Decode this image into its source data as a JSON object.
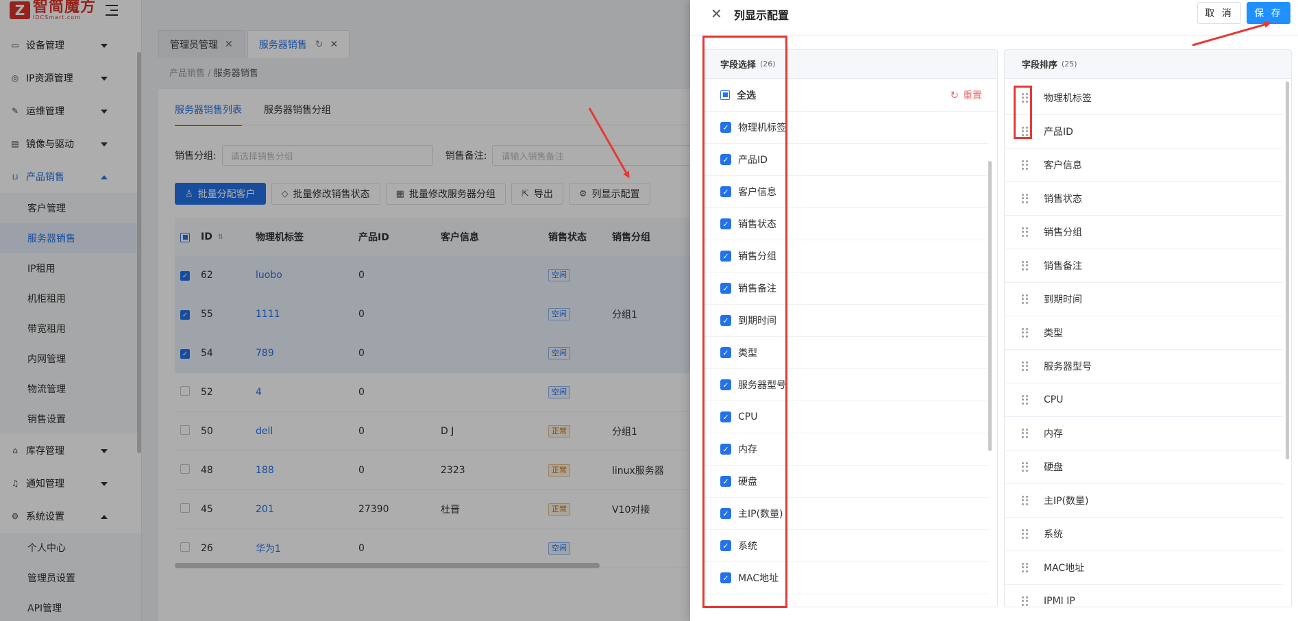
{
  "brand": {
    "logo_mark": "Z",
    "name": "智简魔方",
    "sub": "IDCSmart.com"
  },
  "sidebar": {
    "groups": [
      {
        "label": "设备管理",
        "icon": "monitor-icon",
        "open": false
      },
      {
        "label": "IP资源管理",
        "icon": "network-icon",
        "open": false
      },
      {
        "label": "运维管理",
        "icon": "wrench-icon",
        "open": false
      },
      {
        "label": "镜像与驱动",
        "icon": "image-icon",
        "open": false
      },
      {
        "label": "产品销售",
        "icon": "bag-icon",
        "open": true,
        "active": true,
        "children": [
          "客户管理",
          "服务器销售",
          "IP租用",
          "机柜租用",
          "带宽租用",
          "内网管理",
          "物流管理",
          "销售设置"
        ]
      },
      {
        "label": "库存管理",
        "icon": "warehouse-icon",
        "open": false
      },
      {
        "label": "通知管理",
        "icon": "bell-icon",
        "open": false
      },
      {
        "label": "系统设置",
        "icon": "gear-icon",
        "open": true,
        "children": [
          "个人中心",
          "管理员设置",
          "API管理"
        ]
      }
    ],
    "active_child": "服务器销售"
  },
  "tabs": [
    {
      "label": "管理员管理",
      "active": false
    },
    {
      "label": "服务器销售",
      "active": true
    }
  ],
  "breadcrumb": {
    "parent": "产品销售",
    "sep": "/",
    "current": "服务器销售"
  },
  "sub_tabs": [
    {
      "label": "服务器销售列表",
      "active": true
    },
    {
      "label": "服务器销售分组",
      "active": false
    }
  ],
  "filters": [
    {
      "label": "销售分组:",
      "placeholder": "请选择销售分组"
    },
    {
      "label": "销售备注:",
      "placeholder": "请输入销售备注"
    }
  ],
  "toolbar": [
    {
      "label": "批量分配客户",
      "icon": "user-icon",
      "primary": true
    },
    {
      "label": "批量修改销售状态",
      "icon": "tag-icon",
      "primary": false
    },
    {
      "label": "批量修改服务器分组",
      "icon": "server-icon",
      "primary": false
    },
    {
      "label": "导出",
      "icon": "export-icon",
      "primary": false
    },
    {
      "label": "列显示配置",
      "icon": "gear-icon",
      "primary": false
    }
  ],
  "table": {
    "headers": [
      "ID",
      "物理机标签",
      "产品ID",
      "客户信息",
      "销售状态",
      "销售分组"
    ],
    "rows": [
      {
        "id": "62",
        "tag": "luobo",
        "pid": "0",
        "cust": "",
        "status": "空闲",
        "status_type": "idle",
        "group": "",
        "checked": true
      },
      {
        "id": "55",
        "tag": "1111",
        "pid": "0",
        "cust": "",
        "status": "空闲",
        "status_type": "idle",
        "group": "分组1",
        "checked": true
      },
      {
        "id": "54",
        "tag": "789",
        "pid": "0",
        "cust": "",
        "status": "空闲",
        "status_type": "idle",
        "group": "",
        "checked": true
      },
      {
        "id": "52",
        "tag": "4",
        "pid": "0",
        "cust": "",
        "status": "空闲",
        "status_type": "idle",
        "group": "",
        "checked": false
      },
      {
        "id": "50",
        "tag": "dell",
        "pid": "0",
        "cust": "D J",
        "status": "正常",
        "status_type": "normal",
        "group": "分组1",
        "checked": false
      },
      {
        "id": "48",
        "tag": "188",
        "pid": "0",
        "cust": "2323",
        "status": "正常",
        "status_type": "normal",
        "group": "linux服务器",
        "checked": false
      },
      {
        "id": "45",
        "tag": "201",
        "pid": "27390",
        "cust": "杜晋",
        "status": "正常",
        "status_type": "normal",
        "group": "V10对接",
        "checked": false
      },
      {
        "id": "26",
        "tag": "华为1",
        "pid": "0",
        "cust": "",
        "status": "空闲",
        "status_type": "idle",
        "group": "",
        "checked": false
      }
    ]
  },
  "drawer": {
    "title": "列显示配置",
    "cancel": "取 消",
    "save": "保 存",
    "left": {
      "title": "字段选择",
      "count": "(26)",
      "select_all": "全选",
      "reset": "重置",
      "fields": [
        "物理机标签",
        "产品ID",
        "客户信息",
        "销售状态",
        "销售分组",
        "销售备注",
        "到期时间",
        "类型",
        "服务器型号",
        "CPU",
        "内存",
        "硬盘",
        "主IP(数量)",
        "系统",
        "MAC地址"
      ]
    },
    "right": {
      "title": "字段排序",
      "count": "(25)",
      "fields": [
        "物理机标签",
        "产品ID",
        "客户信息",
        "销售状态",
        "销售分组",
        "销售备注",
        "到期时间",
        "类型",
        "服务器型号",
        "CPU",
        "内存",
        "硬盘",
        "主IP(数量)",
        "系统",
        "MAC地址",
        "IPMI IP"
      ]
    }
  },
  "colors": {
    "accent": "#2472e8",
    "save": "#2190ff",
    "annotation": "#e53935",
    "reset": "#f56c6c"
  }
}
